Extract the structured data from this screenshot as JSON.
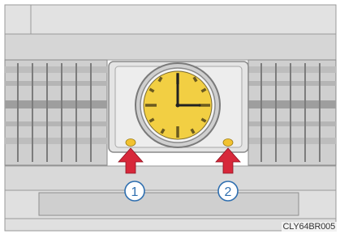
{
  "callouts": [
    {
      "number": "1",
      "glyph": "①"
    },
    {
      "number": "2",
      "glyph": "②"
    }
  ],
  "image_code": "CLY64BR005",
  "colors": {
    "clock_face": "#F2CF43",
    "callout_arrow": "#D7283A",
    "adjust_button": "#F2C230",
    "callout_number": "#2F6FB0",
    "panel": "#DCDCDC"
  },
  "clock": {
    "hour": 3,
    "minute": 0
  }
}
